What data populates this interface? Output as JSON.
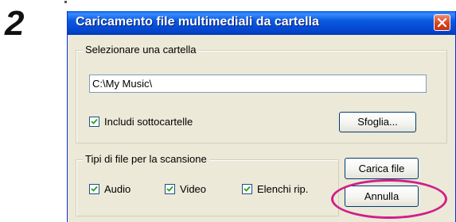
{
  "step_label": "2",
  "dialog": {
    "title": "Caricamento file multimediali da cartella",
    "close_icon": "close-icon",
    "folder_group": {
      "legend": "Selezionare una cartella",
      "path_value": "C:\\My Music\\",
      "include_subfolders": {
        "label": "Includi sottocartelle",
        "checked": true
      },
      "browse_label": "Sfoglia..."
    },
    "file_types_group": {
      "legend": "Tipi di file per la scansione",
      "options": [
        {
          "label": "Audio",
          "checked": true
        },
        {
          "label": "Video",
          "checked": true
        },
        {
          "label": "Elenchi rip.",
          "checked": true
        }
      ]
    },
    "load_label": "Carica file",
    "cancel_label": "Annulla"
  },
  "colors": {
    "title_bar": "#0a5be0",
    "dialog_bg": "#ece9d8",
    "close_button": "#d9441f",
    "highlight": "#d01f8a"
  }
}
